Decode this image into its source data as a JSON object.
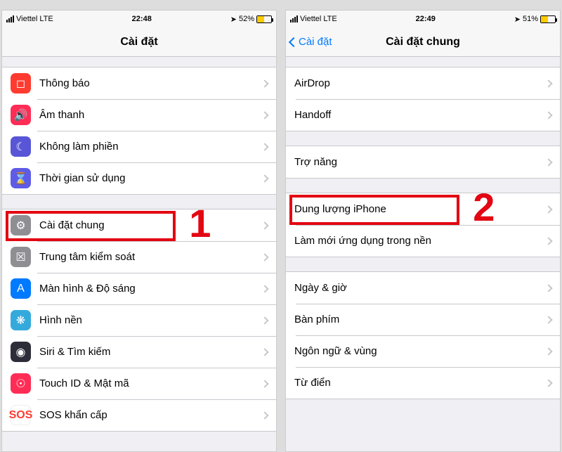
{
  "left": {
    "status": {
      "carrier": "Viettel",
      "net": "LTE",
      "time": "22:48",
      "batt": "52%"
    },
    "title": "Cài đặt",
    "groups": [
      {
        "rows": [
          {
            "icon": "ic-red",
            "glyph": "◻︎",
            "name": "notification",
            "label": "Thông báo"
          },
          {
            "icon": "ic-pink",
            "glyph": "🔊",
            "name": "sounds",
            "label": "Âm thanh"
          },
          {
            "icon": "ic-purple",
            "glyph": "☾",
            "name": "dnd",
            "label": "Không làm phiền"
          },
          {
            "icon": "ic-violet",
            "glyph": "⌛",
            "name": "screen-time",
            "label": "Thời gian sử dụng"
          }
        ]
      },
      {
        "rows": [
          {
            "icon": "ic-gray",
            "glyph": "⚙︎",
            "name": "general",
            "label": "Cài đặt chung",
            "highlight": true
          },
          {
            "icon": "ic-grayd",
            "glyph": "☒",
            "name": "control-center",
            "label": "Trung tâm kiểm soát"
          },
          {
            "icon": "ic-blue",
            "glyph": "A",
            "name": "display",
            "label": "Màn hình & Độ sáng"
          },
          {
            "icon": "ic-teal",
            "glyph": "❋",
            "name": "wallpaper",
            "label": "Hình nền"
          },
          {
            "icon": "ic-indigo",
            "glyph": "◉",
            "name": "siri",
            "label": "Siri & Tìm kiếm"
          },
          {
            "icon": "ic-touch",
            "glyph": "☉",
            "name": "touchid",
            "label": "Touch ID & Mật mã"
          },
          {
            "icon": "ic-sos",
            "glyph": "SOS",
            "name": "sos",
            "label": "SOS khẩn cấp"
          }
        ]
      }
    ],
    "step": "1"
  },
  "right": {
    "status": {
      "carrier": "Viettel",
      "net": "LTE",
      "time": "22:49",
      "batt": "51%"
    },
    "back": "Cài đặt",
    "title": "Cài đặt chung",
    "groups": [
      {
        "rows": [
          {
            "name": "airdrop",
            "label": "AirDrop"
          },
          {
            "name": "handoff",
            "label": "Handoff"
          }
        ]
      },
      {
        "rows": [
          {
            "name": "accessibility",
            "label": "Trợ năng"
          }
        ]
      },
      {
        "rows": [
          {
            "name": "storage",
            "label": "Dung lượng iPhone",
            "highlight": true
          },
          {
            "name": "background-refresh",
            "label": "Làm mới ứng dụng trong nền"
          }
        ]
      },
      {
        "rows": [
          {
            "name": "date-time",
            "label": "Ngày & giờ"
          },
          {
            "name": "keyboard",
            "label": "Bàn phím"
          },
          {
            "name": "language",
            "label": "Ngôn ngữ & vùng"
          },
          {
            "name": "dictionary",
            "label": "Từ điển"
          }
        ]
      }
    ],
    "step": "2"
  }
}
